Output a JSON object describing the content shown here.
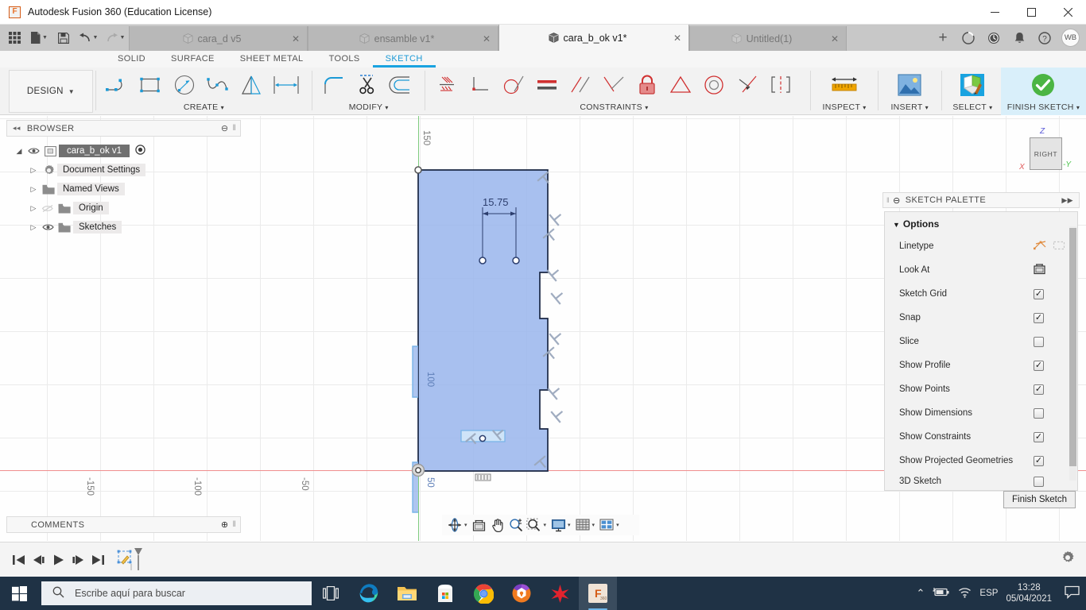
{
  "titlebar": {
    "app_title": "Autodesk Fusion 360 (Education License)",
    "logo_letter": "F",
    "minimize": "–",
    "maximize": "☐",
    "close": "✕"
  },
  "quick_access": {
    "grid_label": "app-grid",
    "new_label": "new-document",
    "save_label": "save",
    "undo_label": "undo",
    "redo_label": "redo"
  },
  "document_tabs": [
    {
      "label": "cara_d v5",
      "close": "✕",
      "active": false
    },
    {
      "label": "ensamble v1*",
      "close": "✕",
      "active": false
    },
    {
      "label": "cara_b_ok v1*",
      "close": "✕",
      "active": true
    },
    {
      "label": "Untitled(1)",
      "close": "✕",
      "active": false
    }
  ],
  "tabbar_right": {
    "add_tab": "+",
    "job_status": "job-status",
    "recent": "recent",
    "notifications": "notifications",
    "help": "?",
    "user_initials": "WB"
  },
  "ribbon_tabs": [
    {
      "label": "SOLID",
      "active": false
    },
    {
      "label": "SURFACE",
      "active": false
    },
    {
      "label": "SHEET METAL",
      "active": false
    },
    {
      "label": "TOOLS",
      "active": false
    },
    {
      "label": "SKETCH",
      "active": true
    }
  ],
  "workspace_selector": {
    "label": "DESIGN",
    "caret": "▾"
  },
  "ribbon_groups": [
    {
      "label": "CREATE",
      "caret": "▾",
      "items": [
        {
          "name": "line-tool"
        },
        {
          "name": "rectangle-tool"
        },
        {
          "name": "circle-tool"
        },
        {
          "name": "spline-tool"
        },
        {
          "name": "mirror-tool"
        },
        {
          "name": "sketch-dimension-tool"
        }
      ]
    },
    {
      "label": "MODIFY",
      "caret": "▾",
      "items": [
        {
          "name": "fillet-tool"
        },
        {
          "name": "trim-tool"
        },
        {
          "name": "offset-tool"
        }
      ]
    },
    {
      "label": "CONSTRAINTS",
      "caret": "▾",
      "items": [
        {
          "name": "fix-unfix-constraint"
        },
        {
          "name": "perpendicular-constraint"
        },
        {
          "name": "tangent-constraint"
        },
        {
          "name": "equal-constraint"
        },
        {
          "name": "parallel-constraint"
        },
        {
          "name": "midpoint-constraint"
        },
        {
          "name": "fix-constraint"
        },
        {
          "name": "coincident-constraint"
        },
        {
          "name": "concentric-constraint"
        },
        {
          "name": "collinear-constraint"
        },
        {
          "name": "symmetry-constraint"
        }
      ]
    },
    {
      "label": "INSPECT",
      "caret": "▾",
      "items": [
        {
          "name": "measure-tool"
        }
      ]
    },
    {
      "label": "INSERT",
      "caret": "▾",
      "items": [
        {
          "name": "insert-image"
        }
      ]
    },
    {
      "label": "SELECT",
      "caret": "▾",
      "items": [
        {
          "name": "select-tool"
        }
      ]
    },
    {
      "label": "FINISH SKETCH",
      "caret": "▾",
      "items": [
        {
          "name": "finish-sketch-check"
        }
      ]
    }
  ],
  "browser": {
    "title": "BROWSER",
    "collapse_icon": "◂◂",
    "dot_icon": "⊖",
    "grip": "‖",
    "tree": [
      {
        "label": "cara_b_ok v1",
        "arrow": "◢",
        "eye": true,
        "icon": "component-icon",
        "radio": true,
        "root": true
      },
      {
        "label": "Document Settings",
        "arrow": "▷",
        "eye": false,
        "icon": "gear-icon"
      },
      {
        "label": "Named Views",
        "arrow": "▷",
        "eye": false,
        "icon": "folder-icon"
      },
      {
        "label": "Origin",
        "arrow": "▷",
        "eye": true,
        "eye_off": true,
        "icon": "folder-icon"
      },
      {
        "label": "Sketches",
        "arrow": "▷",
        "eye": true,
        "icon": "folder-icon"
      }
    ]
  },
  "comments": {
    "title": "COMMENTS",
    "add_icon": "⊕",
    "grip": "‖"
  },
  "canvas": {
    "dimension_label": "15.75",
    "vertical_label_100": "100",
    "vertical_label_50": "50",
    "axis_labels_y": [
      "150"
    ],
    "axis_labels_x": [
      "-150",
      "-100",
      "-50"
    ],
    "profile_fill": "#9ab6ec",
    "profile_stroke": "#1a2744",
    "axis_x_color": "#f08e8e",
    "axis_y_color": "#7ecb7e"
  },
  "viewcube": {
    "face_label": "RIGHT",
    "z_label": "Z",
    "x_label": "X",
    "y_label": "-Y"
  },
  "sketch_palette": {
    "title": "SKETCH PALETTE",
    "dot_icon": "⊖",
    "grip": "‖",
    "expand_icon": "▶▶",
    "section_title": "Options",
    "section_caret": "▼",
    "options": [
      {
        "label": "Linetype",
        "type": "icons",
        "checked": null
      },
      {
        "label": "Look At",
        "type": "icon",
        "checked": null
      },
      {
        "label": "Sketch Grid",
        "type": "checkbox",
        "checked": true
      },
      {
        "label": "Snap",
        "type": "checkbox",
        "checked": true
      },
      {
        "label": "Slice",
        "type": "checkbox",
        "checked": false
      },
      {
        "label": "Show Profile",
        "type": "checkbox",
        "checked": true
      },
      {
        "label": "Show Points",
        "type": "checkbox",
        "checked": true
      },
      {
        "label": "Show Dimensions",
        "type": "checkbox",
        "checked": false
      },
      {
        "label": "Show Constraints",
        "type": "checkbox",
        "checked": true
      },
      {
        "label": "Show Projected Geometries",
        "type": "checkbox",
        "checked": true
      },
      {
        "label": "3D Sketch",
        "type": "checkbox",
        "checked": false
      }
    ],
    "finish_button": "Finish Sketch"
  },
  "navbar": {
    "items": [
      {
        "name": "orbit-tool",
        "caret": "▾"
      },
      {
        "name": "look-at-tool",
        "caret": ""
      },
      {
        "name": "pan-tool",
        "caret": ""
      },
      {
        "name": "zoom-tool",
        "caret": ""
      },
      {
        "name": "zoom-window-tool",
        "caret": "▾"
      },
      {
        "name": "display-settings",
        "caret": "▾"
      },
      {
        "name": "grid-snaps",
        "caret": "▾"
      },
      {
        "name": "viewports",
        "caret": "▾"
      }
    ]
  },
  "timeline": {
    "buttons": [
      {
        "name": "go-to-beginning",
        "glyph": "⏮"
      },
      {
        "name": "step-back",
        "glyph": "◀❘"
      },
      {
        "name": "play",
        "glyph": "▶"
      },
      {
        "name": "step-forward",
        "glyph": "❘▶"
      },
      {
        "name": "go-to-end",
        "glyph": "⏭"
      }
    ],
    "feature_name": "sketch-feature-marker",
    "settings_icon": "⚙"
  },
  "taskbar": {
    "start_label": "start-button",
    "search_placeholder": "Escribe aquí para buscar",
    "task_view": "task-view",
    "apps": [
      {
        "name": "microsoft-edge-icon",
        "running": true
      },
      {
        "name": "file-explorer-icon",
        "running": false
      },
      {
        "name": "microsoft-store-icon",
        "running": false
      },
      {
        "name": "google-chrome-icon",
        "running": true
      },
      {
        "name": "avast-browser-icon",
        "running": false
      },
      {
        "name": "autodesk-icon",
        "running": false
      },
      {
        "name": "fusion360-icon",
        "running": true,
        "active": true
      }
    ],
    "tray": {
      "chevron": "⌃",
      "battery": "battery-icon",
      "wifi": "wifi-icon",
      "language": "ESP",
      "time": "13:28",
      "date": "05/04/2021",
      "action_center": "notifications-icon"
    }
  }
}
